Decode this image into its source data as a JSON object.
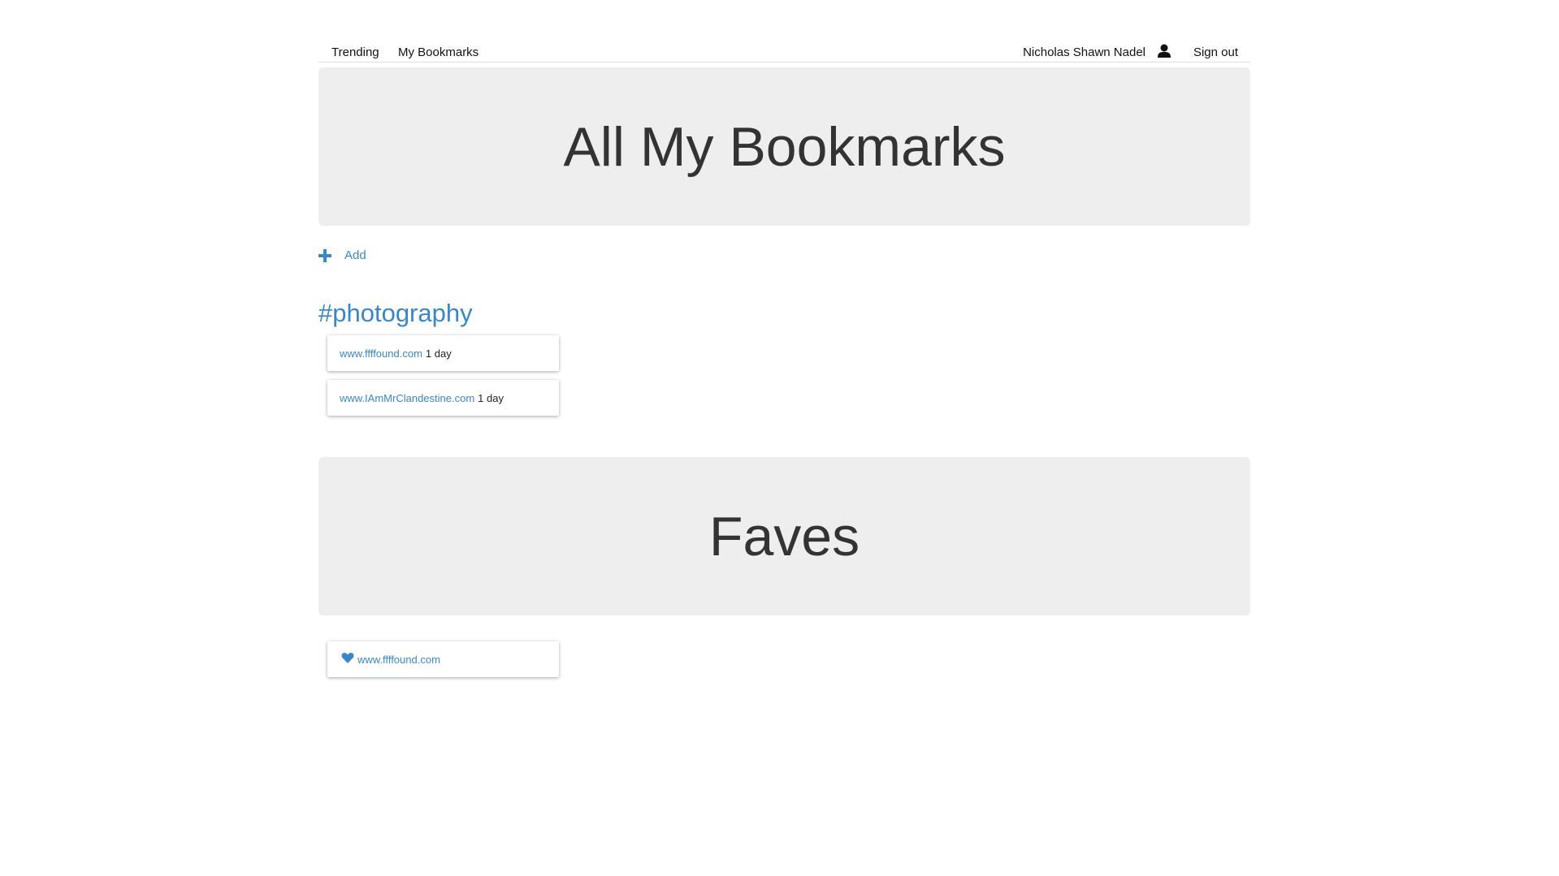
{
  "nav": {
    "trending": "Trending",
    "my_bookmarks": "My Bookmarks",
    "user_name": "Nicholas Shawn Nadel",
    "user_icon": "user-icon",
    "sign_out": "Sign out"
  },
  "bookmarks_section": {
    "title": "All My Bookmarks",
    "add_label": "Add",
    "add_icon": "plus-icon",
    "tag": "#photography",
    "items": [
      {
        "url": "www.ffffound.com",
        "age": "1 day"
      },
      {
        "url": "www.IAmMrClandestine.com",
        "age": "1 day"
      }
    ]
  },
  "faves_section": {
    "title": "Faves",
    "items": [
      {
        "url": "www.ffffound.com",
        "icon": "heart-icon"
      }
    ]
  },
  "colors": {
    "link": "#3a87c8",
    "jumbotron_bg": "#eeeeee",
    "heading_text": "#333333"
  }
}
